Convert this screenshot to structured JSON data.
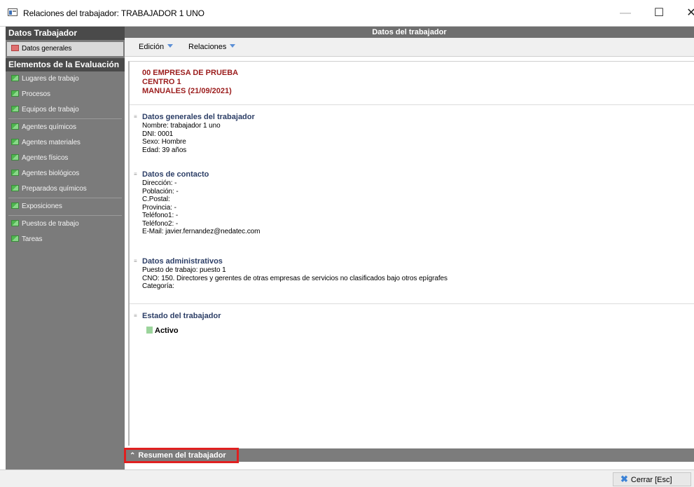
{
  "window": {
    "title": "Relaciones del trabajador: TRABAJADOR 1 UNO",
    "minimize": "—",
    "maximize": "☐",
    "close": "✕"
  },
  "sidebar": {
    "header1": "Datos Trabajador",
    "active_item": "Datos generales",
    "header2": "Elementos de la Evaluación",
    "group1": [
      "Lugares de trabajo",
      "Procesos",
      "Equipos de trabajo"
    ],
    "group2": [
      "Agentes químicos",
      "Agentes materiales",
      "Agentes físicos",
      "Agentes biológicos",
      "Preparados químicos"
    ],
    "group3": [
      "Exposiciones"
    ],
    "group4": [
      "Puestos de trabajo",
      "Tareas"
    ]
  },
  "main": {
    "header": "Datos del trabajador",
    "toolbar": {
      "edicion": "Edición",
      "relaciones": "Relaciones"
    },
    "company": [
      "00 EMPRESA DE PRUEBA",
      "CENTRO 1",
      "MANUALES  (21/09/2021)"
    ],
    "sections": {
      "generales": {
        "title": "Datos generales del trabajador",
        "lines": [
          "Nombre: trabajador 1 uno",
          "DNI: 0001",
          "Sexo: Hombre",
          "Edad: 39 años"
        ]
      },
      "contacto": {
        "title": "Datos de contacto",
        "lines": [
          "Dirección: -",
          "Población: -",
          "C.Postal:",
          "Provincia: -",
          "Teléfono1: -",
          "Teléfono2: -",
          "E-Mail: javier.fernandez@nedatec.com"
        ]
      },
      "administrativos": {
        "title": "Datos administrativos",
        "lines": [
          "Puesto de trabajo: puesto 1",
          "CNO: 150. Directores y gerentes de otras empresas de servicios no clasificados bajo otros epígrafes",
          "Categoría:"
        ]
      },
      "estado": {
        "title": "Estado del trabajador",
        "value": "Activo"
      }
    },
    "summary": "Resumen del trabajador"
  },
  "footer": {
    "close_button": "Cerrar  [Esc]"
  },
  "colors": {
    "company_red": "#9b1c1c",
    "section_title": "#2c3e66",
    "sidebar_bg": "#7b7b7b",
    "highlight_border": "#e02020"
  }
}
